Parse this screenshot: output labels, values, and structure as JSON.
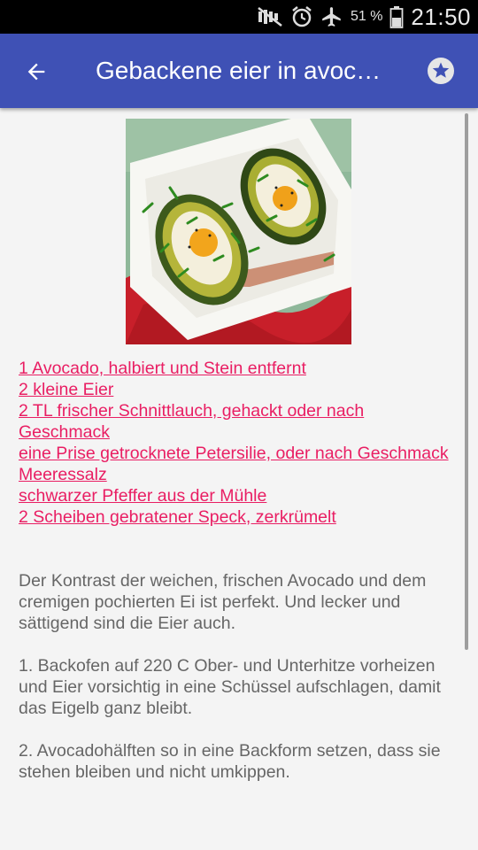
{
  "status_bar": {
    "battery_percent": "51 %",
    "time": "21:50",
    "icons": [
      "mute-icon",
      "alarm-icon",
      "airplane-icon",
      "battery-icon"
    ]
  },
  "app_bar": {
    "title": "Gebackene eier in avoc…",
    "back_icon": "arrow-back-icon",
    "favorite_icon": "star-icon",
    "color": "#3f51b5"
  },
  "recipe": {
    "ingredients": [
      "1 Avocado, halbiert und Stein entfernt",
      "2 kleine Eier",
      "2 TL frischer Schnittlauch, gehackt oder nach Geschmack",
      "eine Prise getrocknete Petersilie, oder nach Geschmack",
      "Meeressalz",
      "schwarzer Pfeffer aus der Mühle",
      "2 Scheiben gebratener Speck, zerkrümelt"
    ],
    "paragraphs": [
      "Der Kontrast der weichen, frischen Avocado und dem cremigen pochierten Ei ist perfekt. Und lecker und sättigend sind die Eier auch.",
      "1. Backofen auf 220 C Ober- und Unterhitze vorheizen und Eier vorsichtig in eine Schüssel aufschlagen, damit das Eigelb ganz bleibt.",
      "2. Avocadohälften so in eine Backform setzen, dass sie stehen bleiben und nicht umkippen."
    ],
    "link_color": "#e91e63",
    "text_color": "#666666"
  }
}
